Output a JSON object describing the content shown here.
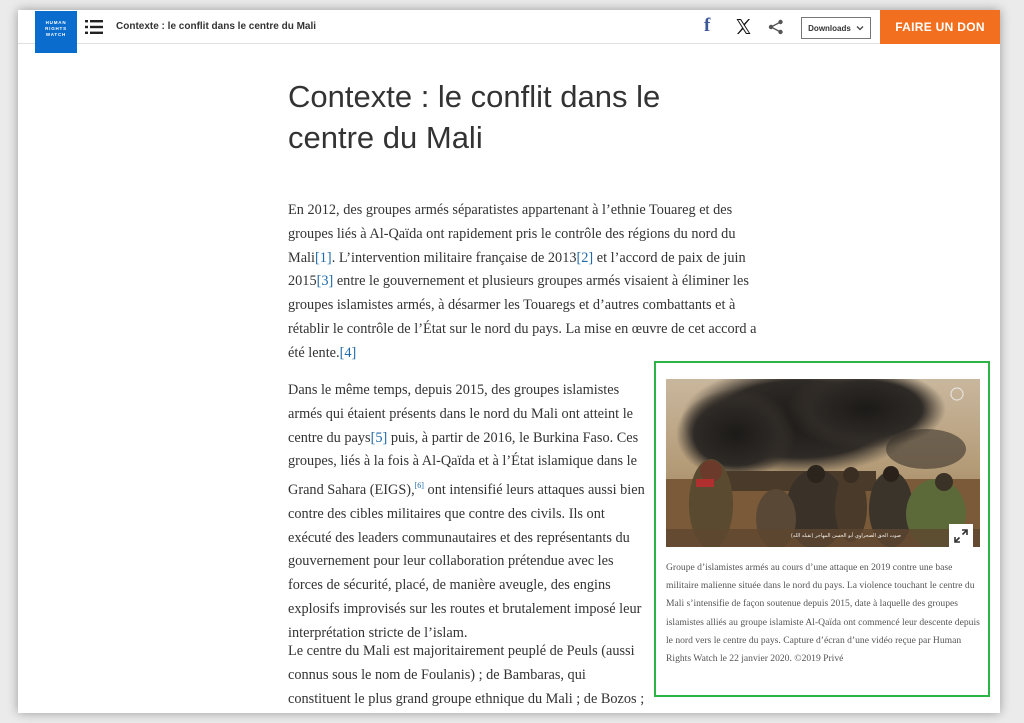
{
  "topbar": {
    "logo_lines": [
      "HUMAN",
      "RIGHTS",
      "WATCH"
    ],
    "title": "Contexte : le conflit dans le centre du Mali",
    "facebook_glyph": "f",
    "downloads_label": "Downloads",
    "donate_label": "FAIRE UN DON",
    "icons": [
      "menu-icon",
      "facebook-icon",
      "x-icon",
      "share-icon",
      "chevron-down-icon"
    ]
  },
  "article": {
    "heading_line1": "Contexte : le conflit dans le",
    "heading_line2": "centre du Mali",
    "p1": {
      "t1": "En 2012, des groupes armés séparatistes appartenant à l’ethnie Touareg et des groupes liés à Al-Qaïda ont rapidement pris le contrôle des régions du nord du Mali",
      "ref1": "[1]",
      "t2": ". L’intervention militaire française de 2013",
      "ref2": "[2]",
      "t3": " et l’accord de paix de juin 2015",
      "ref3": "[3]",
      "t4": " entre le gouvernement et plusieurs groupes armés visaient à éliminer les groupes islamistes armés, à désarmer les Touaregs et d’autres combattants et à rétablir le contrôle de l’État sur le nord du pays. La mise en œuvre de cet accord a été lente.",
      "ref4": "[4]"
    },
    "p2": {
      "t1": "Dans le même temps, depuis 2015, des groupes islamistes armés qui étaient présents dans le nord du Mali ont atteint le centre du pays",
      "ref5": "[5]",
      "t2": " puis, à partir de 2016, le Burkina Faso. Ces groupes, liés à la fois à Al-Qaïda et à l’État islamique dans le Grand Sahara (EIGS),",
      "ref6": "[6]",
      "t3": " ont intensifié leurs attaques aussi bien contre des cibles militaires que contre des civils. Ils ont exécuté des leaders communautaires et des représentants du gouvernement pour leur collaboration prétendue avec les forces de sécurité, placé, de manière aveugle, des engins explosifs improvisés sur les routes et brutalement imposé leur interprétation stricte de l’islam."
    },
    "p3": "Le centre du Mali est majoritairement peuplé de Peuls (aussi connus sous le nom de Foulanis) ; de Bambaras, qui constituent le plus grand groupe ethnique du Mali ; de Bozos ; et de Dogons"
  },
  "figure": {
    "photo_overlay_text": "صوت الحق الصحراوي أبو الحسن المهاجر (تقبله الله)",
    "caption": "Groupe d’islamistes armés au cours d’une attaque en 2019 contre une base militaire malienne située dans le nord du pays. La violence touchant le centre du Mali s’intensifie de façon soutenue depuis 2015, date à laquelle des groupes islamistes alliés au groupe islamiste Al-Qaïda ont commencé leur descente depuis le nord vers le centre du pays. Capture d’écran d’une vidéo reçue par Human Rights Watch le 22 janvier 2020.  ©2019 Privé",
    "accent_color": "#2cb546"
  },
  "colors": {
    "logo_blue": "#0a6ccc",
    "donate_orange": "#f26f1f",
    "link_blue": "#1f69a8",
    "facebook_blue": "#3b5998"
  }
}
